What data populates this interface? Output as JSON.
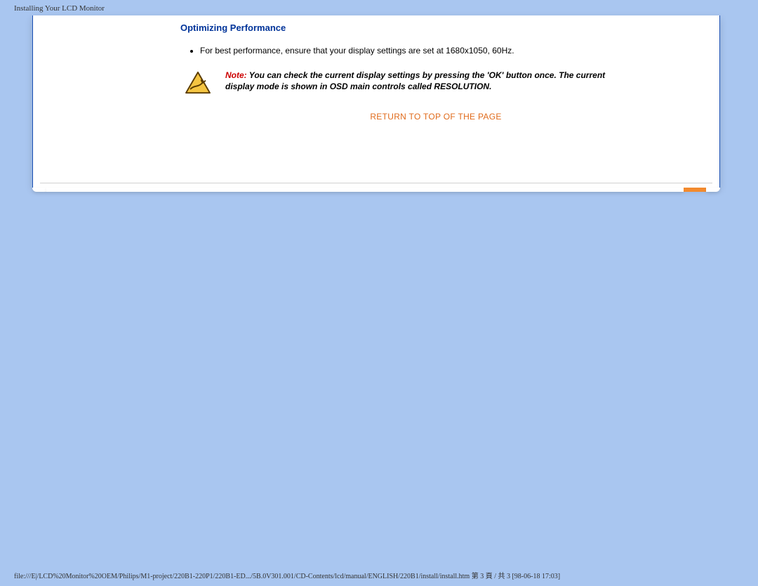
{
  "header": {
    "title": "Installing Your LCD Monitor"
  },
  "section": {
    "heading": "Optimizing Performance",
    "bullet": "For best performance, ensure that your display settings are set at 1680x1050, 60Hz.",
    "note_label": "Note:",
    "note_body": " You can check the current display settings by pressing the 'OK' button once. The current display mode is shown in OSD main controls called RESOLUTION."
  },
  "links": {
    "return_top_label": "RETURN TO TOP OF THE PAGE"
  },
  "footer": {
    "path": "file:///E|/LCD%20Monitor%20OEM/Philips/M1-project/220B1-220P1/220B1-ED.../5B.0V301.001/CD-Contents/lcd/manual/ENGLISH/220B1/install/install.htm 第 3 頁 / 共 3  [98-06-18 17:03]"
  },
  "icons": {
    "warning": "warning-triangle"
  }
}
